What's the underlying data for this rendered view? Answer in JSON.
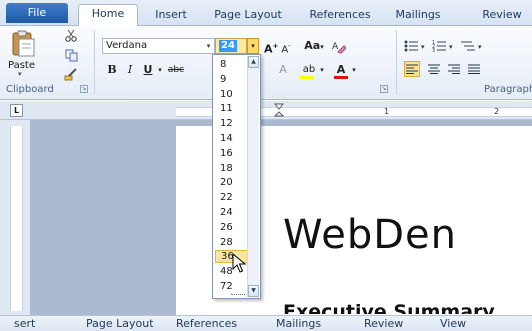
{
  "tabs": [
    {
      "label": "File"
    },
    {
      "label": "Home"
    },
    {
      "label": "Insert"
    },
    {
      "label": "Page Layout"
    },
    {
      "label": "References"
    },
    {
      "label": "Mailings"
    },
    {
      "label": "Review"
    }
  ],
  "clipboard": {
    "paste_label": "Paste",
    "group_label": "Clipboard"
  },
  "font": {
    "name": "Verdana",
    "size": "24",
    "grow_label": "A",
    "shrink_label": "A",
    "change_case_label": "Aa",
    "bold_label": "B",
    "italic_label": "I",
    "underline_label": "U",
    "strike_label": "abc",
    "highlight_label": "ab",
    "color_label": "A",
    "clear_label": "A"
  },
  "paragraph": {
    "group_label": "Paragraph"
  },
  "font_size_options": [
    "8",
    "9",
    "10",
    "11",
    "12",
    "14",
    "16",
    "18",
    "20",
    "22",
    "24",
    "26",
    "28",
    "36",
    "48",
    "72"
  ],
  "highlighted_option": "36",
  "ruler": {
    "corner_label": "L",
    "marks": [
      "1",
      "2"
    ]
  },
  "document": {
    "title": "WebDen",
    "heading": "Executive Summary"
  },
  "bottom_bar": [
    {
      "label": "sert"
    },
    {
      "label": "Page Layout"
    },
    {
      "label": "References"
    },
    {
      "label": "Mailings"
    },
    {
      "label": "Review"
    },
    {
      "label": "View"
    }
  ],
  "colors": {
    "file_tab": "#2a66b4",
    "highlight": "#fce59a",
    "selection": "#3399ff",
    "font_color_bar": "#e01010",
    "highlight_color_bar": "#ffff00"
  }
}
